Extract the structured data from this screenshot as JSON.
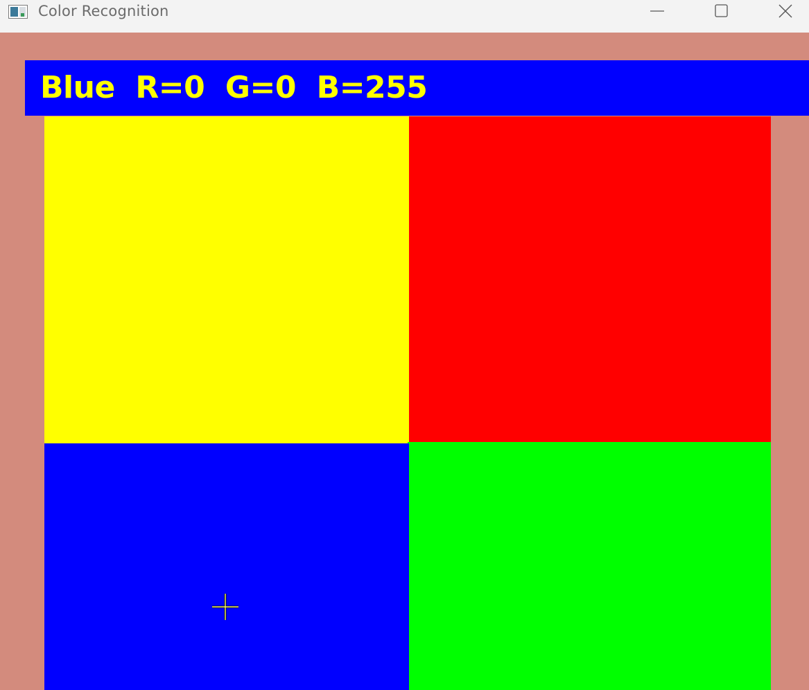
{
  "window": {
    "title": "Color Recognition",
    "icon": "app-window-icon",
    "controls": {
      "minimize_icon": "minimize-icon",
      "maximize_icon": "maximize-icon",
      "close_icon": "close-icon"
    }
  },
  "canvas": {
    "background_color": "#d38b7d",
    "banner": {
      "text": "Blue  R=0  G=0  B=255",
      "background_color": "#0000ff",
      "text_color": "#ffff00"
    },
    "quadrants": [
      {
        "name": "yellow",
        "color": "#ffff00"
      },
      {
        "name": "red",
        "color": "#ff0000"
      },
      {
        "name": "blue",
        "color": "#0000ff"
      },
      {
        "name": "green",
        "color": "#00ff00"
      }
    ],
    "cursor": "crosshair-cursor-icon"
  }
}
